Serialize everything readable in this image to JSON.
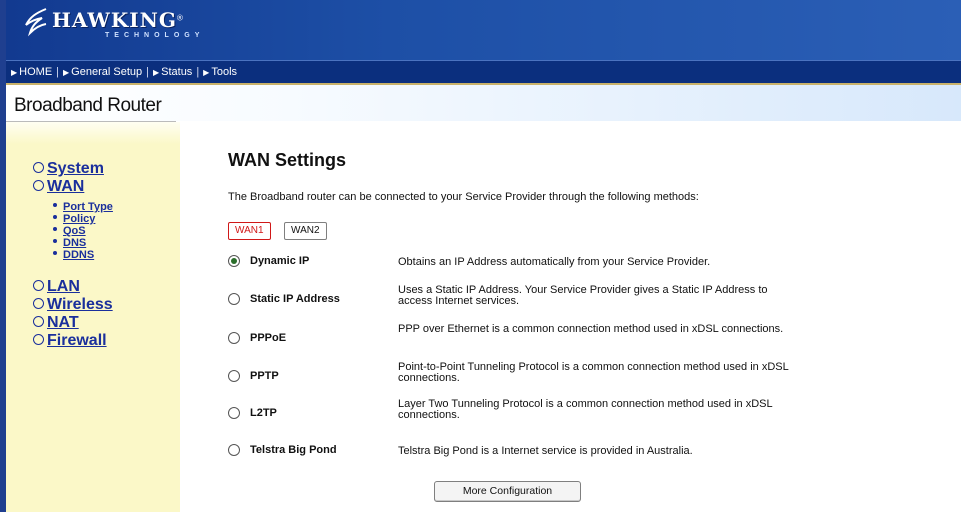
{
  "header": {
    "brand": "HAWKING",
    "brand_sub": "TECHNOLOGY",
    "registered": "®"
  },
  "nav": {
    "items": [
      {
        "label": "HOME"
      },
      {
        "label": "General Setup"
      },
      {
        "label": "Status"
      },
      {
        "label": "Tools"
      }
    ],
    "separator": "|"
  },
  "page_title": "Broadband Router",
  "sidebar": {
    "items": [
      {
        "label": "System"
      },
      {
        "label": "WAN"
      },
      {
        "label": "LAN"
      },
      {
        "label": "Wireless"
      },
      {
        "label": "NAT"
      },
      {
        "label": "Firewall"
      }
    ],
    "wan_sub": [
      {
        "label": "Port Type"
      },
      {
        "label": "Policy"
      },
      {
        "label": "QoS"
      },
      {
        "label": "DNS"
      },
      {
        "label": "DDNS"
      }
    ]
  },
  "main": {
    "title": "WAN Settings",
    "intro": "The Broadband router can be connected to your Service Provider through the following methods:",
    "wan_tabs": [
      "WAN1",
      "WAN2"
    ],
    "options": [
      {
        "label": "Dynamic IP",
        "desc": "Obtains an IP Address automatically from your Service Provider.",
        "selected": true
      },
      {
        "label": "Static IP Address",
        "desc": "Uses a Static IP Address. Your Service Provider gives a Static IP Address to access Internet services.",
        "selected": false
      },
      {
        "label": "PPPoE",
        "desc": "PPP over Ethernet is a common connection method used in xDSL connections.",
        "selected": false
      },
      {
        "label": "PPTP",
        "desc": "Point-to-Point Tunneling Protocol is a common connection method used in xDSL connections.",
        "selected": false
      },
      {
        "label": "L2TP",
        "desc": "Layer Two Tunneling Protocol is a common connection method used in xDSL connections.",
        "selected": false
      },
      {
        "label": "Telstra Big Pond",
        "desc": "Telstra Big Pond is a Internet service is provided in Australia.",
        "selected": false
      }
    ],
    "more_button": "More Configuration"
  },
  "colors": {
    "header_blue": "#1d4fa6",
    "nav_blue": "#0b2f7e",
    "sidebar_bg": "#fbf8c8",
    "link_blue": "#1a2f9c",
    "wan1_red": "#d01818"
  },
  "icons": [
    "hawk-logo-icon",
    "nav-arrow-icon",
    "menu-ring-icon",
    "bullet-icon",
    "radio-button-icon"
  ]
}
